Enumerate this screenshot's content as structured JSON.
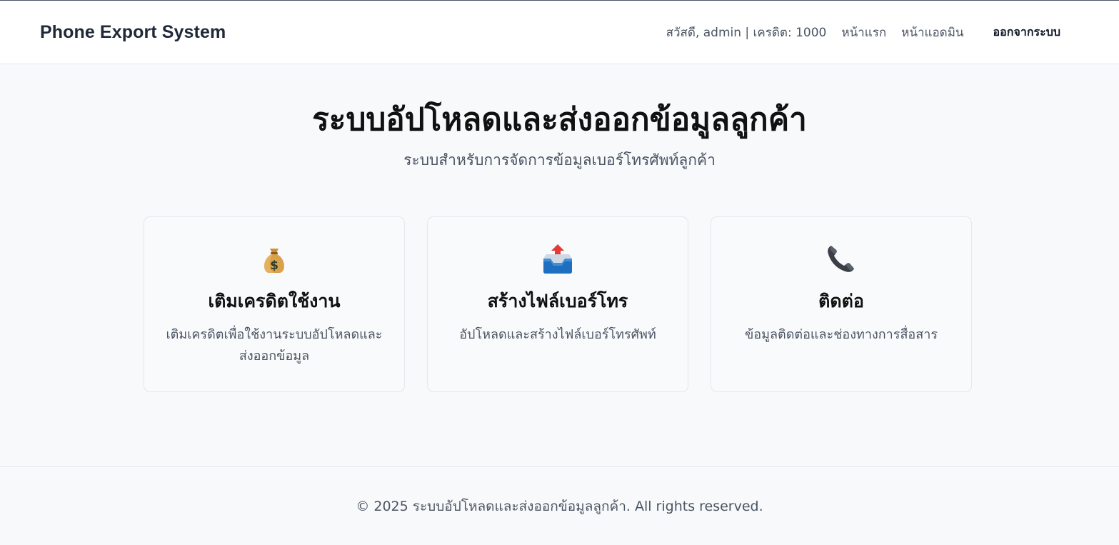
{
  "header": {
    "brand": "Phone Export System",
    "greeting": "สวัสดี, admin | เครดิต: 1000",
    "nav": {
      "home": "หน้าแรก",
      "admin": "หน้าแอดมิน",
      "logout": "ออกจากระบบ"
    }
  },
  "hero": {
    "title": "ระบบอัปโหลดและส่งออกข้อมูลลูกค้า",
    "subtitle": "ระบบสำหรับการจัดการข้อมูลเบอร์โทรศัพท์ลูกค้า"
  },
  "cards": [
    {
      "icon": "money-bag-icon",
      "title": "เติมเครดิตใช้งาน",
      "desc": "เติมเครดิตเพื่อใช้งานระบบอัปโหลดและส่งออกข้อมูล"
    },
    {
      "icon": "outbox-tray-icon",
      "title": "สร้างไฟล์เบอร์โทร",
      "desc": "อัปโหลดและสร้างไฟล์เบอร์โทรศัพท์"
    },
    {
      "icon": "telephone-icon",
      "title": "ติดต่อ",
      "desc": "ข้อมูลติดต่อและช่องทางการสื่อสาร"
    }
  ],
  "footer": {
    "text": "© 2025 ระบบอัปโหลดและส่งออกข้อมูลลูกค้า. All rights reserved."
  }
}
